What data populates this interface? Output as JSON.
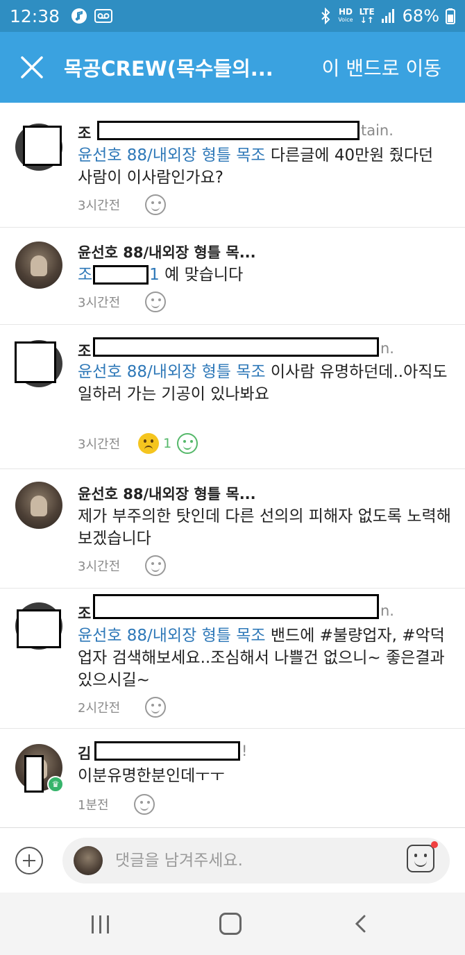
{
  "status_bar": {
    "time": "12:38",
    "network_top": "HD",
    "network_bottom": "Voice",
    "lte_top": "LTE",
    "lte_bottom": "↓↑",
    "battery": "68%"
  },
  "header": {
    "title": "목공CREW(목수들의...",
    "action": "이 밴드로 이동",
    "bg_color": "#3aa2e0"
  },
  "comments": [
    {
      "author_prefix": "조",
      "author_suffix": "tain.",
      "mention": "윤선호 88/내외장 형틀 목조",
      "text": " 다른글에 40만원 줬다던 사람이 이사람인가요?",
      "time": "3시간전"
    },
    {
      "author": "윤선호 88/내외장 형틀 목...",
      "mention_prefix": "조",
      "mention_suffix": "1",
      "text": " 예 맞습니다",
      "time": "3시간전"
    },
    {
      "author_prefix": "조",
      "author_suffix": "n.",
      "mention": "윤선호 88/내외장 형틀 목조",
      "text": " 이사람 유명하던데..아직도 일하러 가는 기공이 있나봐요",
      "time": "3시간전",
      "reaction_count": "1"
    },
    {
      "author": "윤선호 88/내외장 형틀 목...",
      "text": "제가 부주의한 탓인데 다른 선의의 피해자 없도록 노력해보겠습니다",
      "time": "3시간전"
    },
    {
      "author_prefix": "조",
      "author_suffix": "n.",
      "mention": "윤선호 88/내외장 형틀 목조",
      "text": " 밴드에 #불량업자, #악덕업자 검색해보세요..조심해서 나쁠건 없으니~ 좋은결과 있으시길~",
      "time": "2시간전"
    },
    {
      "author_prefix": "김",
      "author_suffix": "!",
      "text": "이분유명한분인데ㅜㅜ",
      "time": "1분전"
    }
  ],
  "composer": {
    "placeholder": "댓글을 남겨주세요."
  },
  "icons": {
    "close": "close-icon",
    "add": "plus-icon",
    "sticker": "sticker-icon",
    "smile": "smile-icon",
    "sad": "sad-face-icon"
  }
}
